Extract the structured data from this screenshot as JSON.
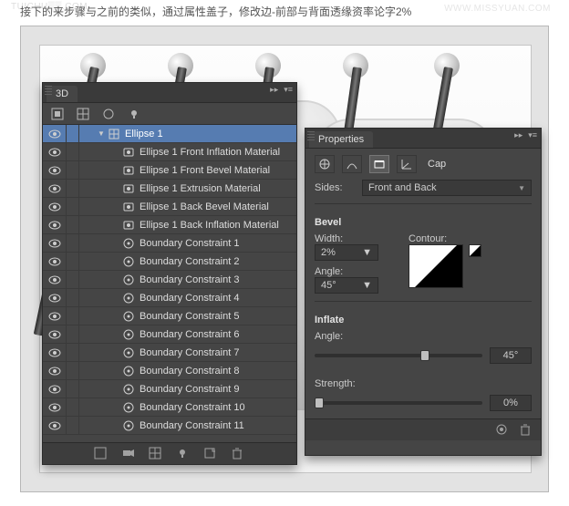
{
  "instruction_text": "接下的来步骤与之前的类似，通过属性盖子，修改边-前部与背面透缘资率论字2%",
  "watermark_left": "TUICHU▒▒.COM",
  "watermark_right": "WWW.MISSYUAN.COM",
  "panel3d": {
    "tab": "3D",
    "layers": [
      {
        "indent": 1,
        "icon": "mesh",
        "label": "Ellipse 1",
        "twisty": "▼",
        "selected": true
      },
      {
        "indent": 2,
        "icon": "mat",
        "label": "Ellipse 1 Front Inflation Material"
      },
      {
        "indent": 2,
        "icon": "mat",
        "label": "Ellipse 1 Front Bevel Material"
      },
      {
        "indent": 2,
        "icon": "mat",
        "label": "Ellipse 1 Extrusion Material"
      },
      {
        "indent": 2,
        "icon": "mat",
        "label": "Ellipse 1 Back Bevel Material"
      },
      {
        "indent": 2,
        "icon": "mat",
        "label": "Ellipse 1 Back Inflation Material"
      },
      {
        "indent": 2,
        "icon": "target",
        "label": "Boundary Constraint 1"
      },
      {
        "indent": 2,
        "icon": "target",
        "label": "Boundary Constraint 2"
      },
      {
        "indent": 2,
        "icon": "target",
        "label": "Boundary Constraint 3"
      },
      {
        "indent": 2,
        "icon": "target",
        "label": "Boundary Constraint 4"
      },
      {
        "indent": 2,
        "icon": "target",
        "label": "Boundary Constraint 5"
      },
      {
        "indent": 2,
        "icon": "target",
        "label": "Boundary Constraint 6"
      },
      {
        "indent": 2,
        "icon": "target",
        "label": "Boundary Constraint 7"
      },
      {
        "indent": 2,
        "icon": "target",
        "label": "Boundary Constraint 8"
      },
      {
        "indent": 2,
        "icon": "target",
        "label": "Boundary Constraint 9"
      },
      {
        "indent": 2,
        "icon": "target",
        "label": "Boundary Constraint 10"
      },
      {
        "indent": 2,
        "icon": "target",
        "label": "Boundary Constraint 11"
      }
    ]
  },
  "properties": {
    "tab": "Properties",
    "mode_label": "Cap",
    "sides_label": "Sides:",
    "sides_value": "Front and Back",
    "bevel": {
      "title": "Bevel",
      "width_label": "Width:",
      "width_value": "2%",
      "contour_label": "Contour:",
      "angle_label": "Angle:",
      "angle_value": "45°"
    },
    "inflate": {
      "title": "Inflate",
      "angle_label": "Angle:",
      "angle_value": "45°",
      "angle_pct": 63,
      "strength_label": "Strength:",
      "strength_value": "0%",
      "strength_pct": 0
    }
  }
}
